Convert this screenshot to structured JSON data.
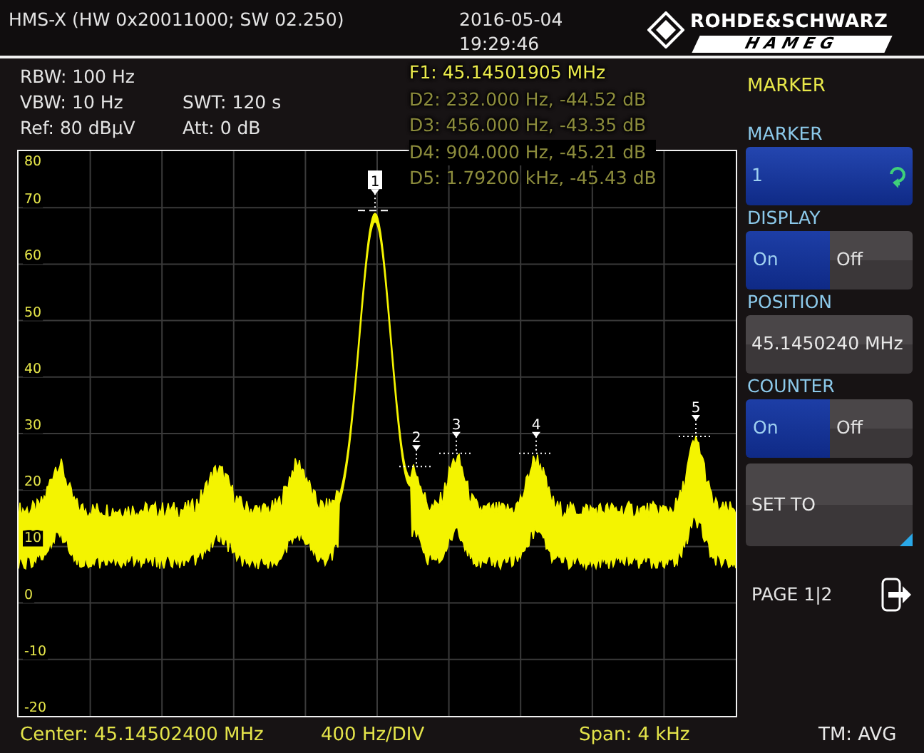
{
  "header": {
    "title": "HMS-X (HW 0x20011000; SW 02.250)",
    "date": "2016-05-04",
    "time": "19:29:46",
    "logo": {
      "line_1": "ROHDE&SCHWARZ",
      "line_2": "HAMEG"
    }
  },
  "settings": {
    "rbw": "RBW: 100 Hz",
    "vbw": "VBW: 10 Hz",
    "ref": "Ref: 80 dBµV",
    "swt": "SWT: 120 s",
    "att": "Att: 0 dB"
  },
  "marker_readouts": [
    {
      "text": "F1: 45.14501905 MHz",
      "active": true
    },
    {
      "text": "D2: 232.000 Hz, -44.52 dB",
      "active": false
    },
    {
      "text": "D3: 456.000 Hz, -43.35 dB",
      "active": false
    },
    {
      "text": "D4: 904.000 Hz, -45.21 dB",
      "active": false
    },
    {
      "text": "D5: 1.79200 kHz, -45.43 dB",
      "active": false
    }
  ],
  "plot": {
    "y_labels": [
      "80",
      "70",
      "60",
      "50",
      "40",
      "30",
      "20",
      "10",
      "0",
      "-10",
      "-20"
    ],
    "markers": [
      {
        "label": "1",
        "selected": true
      },
      {
        "label": "2",
        "selected": false
      },
      {
        "label": "3",
        "selected": false
      },
      {
        "label": "4",
        "selected": false
      },
      {
        "label": "5",
        "selected": false
      }
    ]
  },
  "menu_title": "MARKER",
  "softkeys": [
    {
      "kind": "selector",
      "label": "MARKER",
      "value": "1"
    },
    {
      "kind": "toggle",
      "label": "DISPLAY",
      "options": [
        {
          "label": "On",
          "selected": true
        },
        {
          "label": "Off",
          "selected": false
        }
      ]
    },
    {
      "kind": "value",
      "label": "POSITION",
      "value": "45.1450240 MHz"
    },
    {
      "kind": "toggle",
      "label": "COUNTER",
      "options": [
        {
          "label": "On",
          "selected": true
        },
        {
          "label": "Off",
          "selected": false
        }
      ]
    },
    {
      "kind": "action",
      "label": "SET TO"
    }
  ],
  "page": "PAGE 1|2",
  "status_bar": {
    "center": "Center: 45.14502400 MHz",
    "scale": "400 Hz/DIV",
    "span": "Span: 4 kHz",
    "trace_mode": "TM: AVG"
  }
}
